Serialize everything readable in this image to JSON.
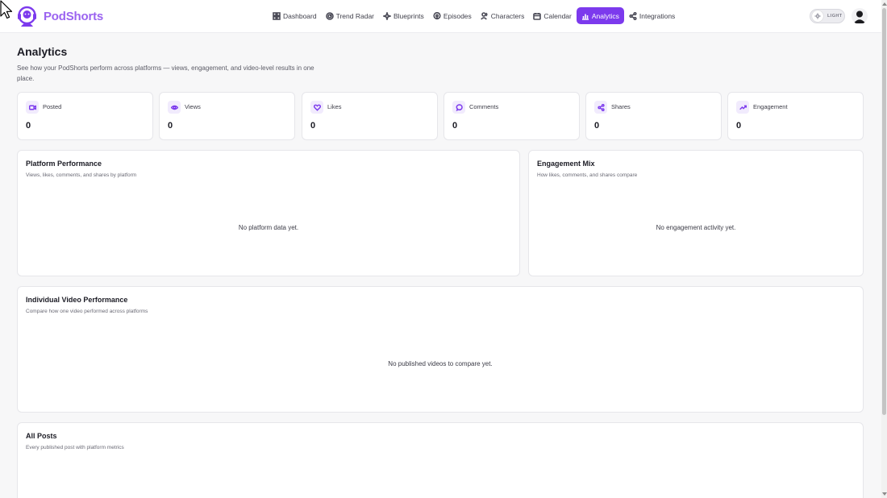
{
  "app": {
    "brand_name": "PodShorts",
    "accent_color": "#7c3aed",
    "brand_color": "#9b63f0"
  },
  "nav": {
    "items": [
      {
        "label": "Dashboard",
        "icon": "grid-icon"
      },
      {
        "label": "Trend Radar",
        "icon": "radar-icon"
      },
      {
        "label": "Blueprints",
        "icon": "sparkles-icon"
      },
      {
        "label": "Episodes",
        "icon": "podcast-icon"
      },
      {
        "label": "Characters",
        "icon": "users-icon"
      },
      {
        "label": "Calendar",
        "icon": "calendar-icon"
      },
      {
        "label": "Analytics",
        "icon": "bar-chart-icon",
        "active": true
      },
      {
        "label": "Integrations",
        "icon": "share-nodes-icon"
      }
    ],
    "theme_label": "LIGHT"
  },
  "header": {
    "title": "Analytics",
    "subtitle": "See how your PodShorts perform across platforms — views, engagement, and video-level results in one place."
  },
  "stats": [
    {
      "label": "Posted",
      "value": "0",
      "icon": "video-icon"
    },
    {
      "label": "Views",
      "value": "0",
      "icon": "eye-icon"
    },
    {
      "label": "Likes",
      "value": "0",
      "icon": "heart-icon"
    },
    {
      "label": "Comments",
      "value": "0",
      "icon": "message-icon"
    },
    {
      "label": "Shares",
      "value": "0",
      "icon": "share-icon"
    },
    {
      "label": "Engagement",
      "value": "0",
      "icon": "trending-up-icon"
    }
  ],
  "panels": {
    "platform": {
      "title": "Platform Performance",
      "subtitle": "Views, likes, comments, and shares by platform",
      "empty": "No platform data yet."
    },
    "engagement": {
      "title": "Engagement Mix",
      "subtitle": "How likes, comments, and shares compare",
      "empty": "No engagement activity yet."
    },
    "video": {
      "title": "Individual Video Performance",
      "subtitle": "Compare how one video performed across platforms",
      "empty": "No published videos to compare yet."
    },
    "posts": {
      "title": "All Posts",
      "subtitle": "Every published post with platform metrics"
    }
  }
}
